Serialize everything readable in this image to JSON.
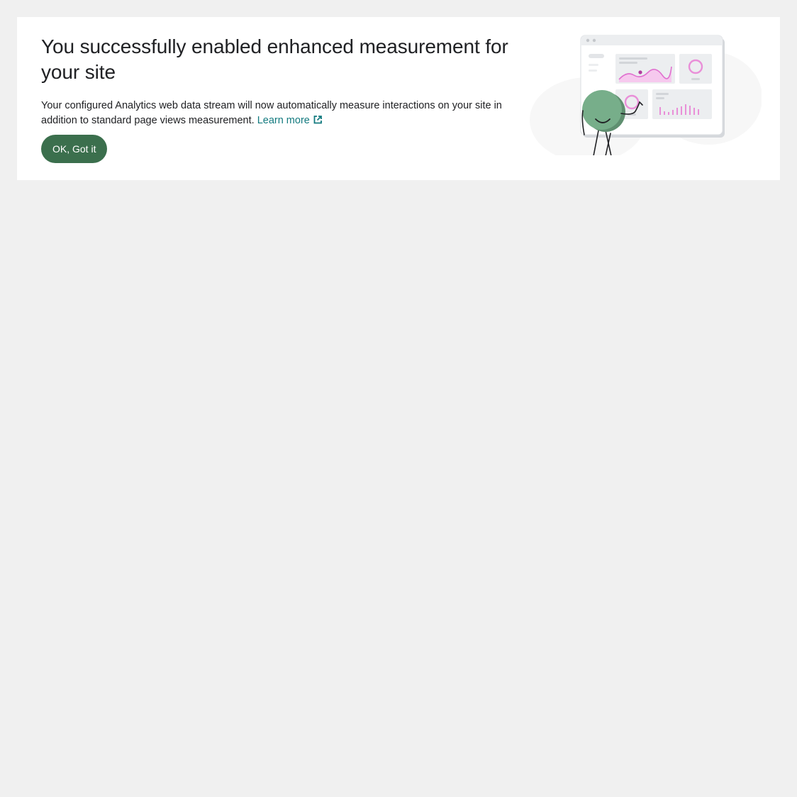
{
  "banner": {
    "title": "You successfully enabled enhanced measurement for your site",
    "description": "Your configured Analytics web data stream will now automatically measure interactions on your site in addition to standard page views measurement.",
    "learn_more": "Learn more",
    "ok_button": "OK, Got it"
  },
  "colors": {
    "page_background": "#f0f0f0",
    "card_background": "#ffffff",
    "text": "#202124",
    "link": "#137a7f",
    "button": "#3b6f4d",
    "character": "#77ae8a",
    "chart_accent": "#e98fd8"
  },
  "icons": {
    "learn_more": "open-in-new-icon",
    "illustration": "analytics-dashboard-illustration"
  }
}
